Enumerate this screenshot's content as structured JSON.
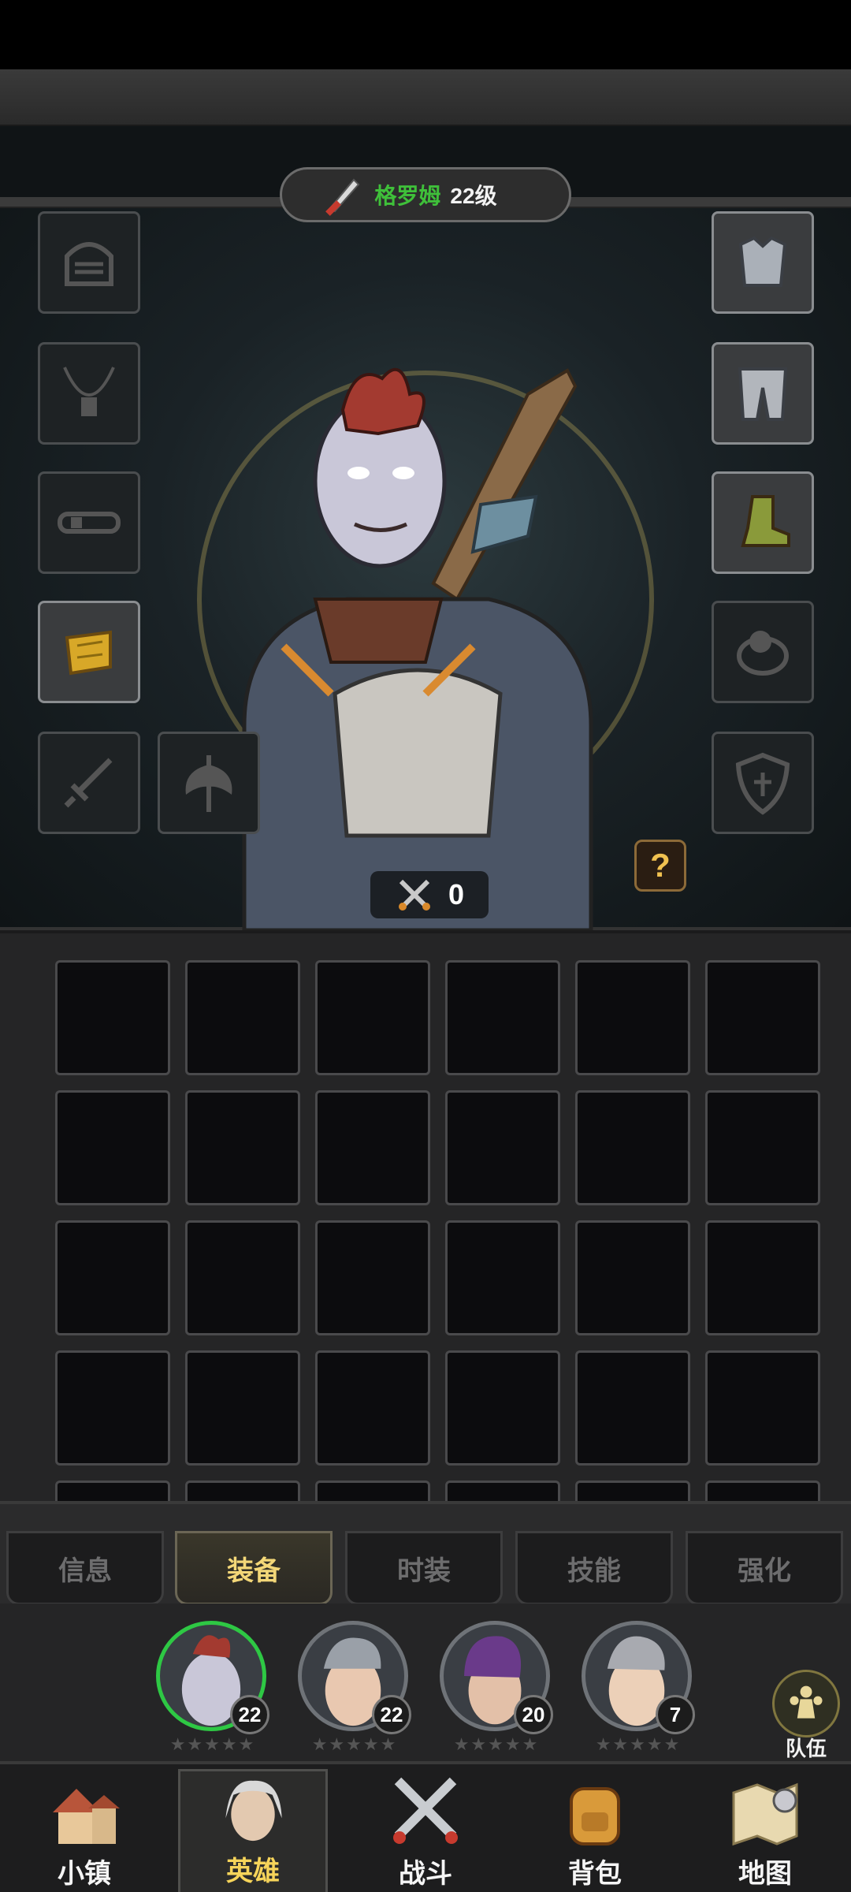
{
  "hero": {
    "name": "格罗姆",
    "level": "22级",
    "power": "0",
    "help": "?"
  },
  "equip_slots": {
    "left": [
      "helmet-icon",
      "necklace-icon",
      "belt-icon",
      "bracer-icon",
      "sword-icon",
      "axe-icon"
    ],
    "right": [
      "chest-armor-icon",
      "leg-armor-icon",
      "boots-icon",
      "ring-icon",
      "shield-icon"
    ]
  },
  "tabs": [
    {
      "label": "信息",
      "active": false
    },
    {
      "label": "装备",
      "active": true
    },
    {
      "label": "时装",
      "active": false
    },
    {
      "label": "技能",
      "active": false
    },
    {
      "label": "强化",
      "active": false
    }
  ],
  "heroes": [
    {
      "level": "22",
      "stars": "★★★★★",
      "active": true
    },
    {
      "level": "22",
      "stars": "★★★★★",
      "active": false
    },
    {
      "level": "20",
      "stars": "★★★★★",
      "active": false
    },
    {
      "level": "7",
      "stars": "★★★★★",
      "active": false
    }
  ],
  "team": {
    "label": "队伍"
  },
  "nav": [
    {
      "label": "小镇",
      "icon": "town-icon",
      "active": false
    },
    {
      "label": "英雄",
      "icon": "hero-icon",
      "active": true
    },
    {
      "label": "战斗",
      "icon": "battle-icon",
      "active": false
    },
    {
      "label": "背包",
      "icon": "backpack-icon",
      "active": false
    },
    {
      "label": "地图",
      "icon": "map-icon",
      "active": false
    }
  ],
  "colors": {
    "name_green": "#3fc03a",
    "tab_active": "#f3d778",
    "nav_active": "#f6d45a"
  }
}
